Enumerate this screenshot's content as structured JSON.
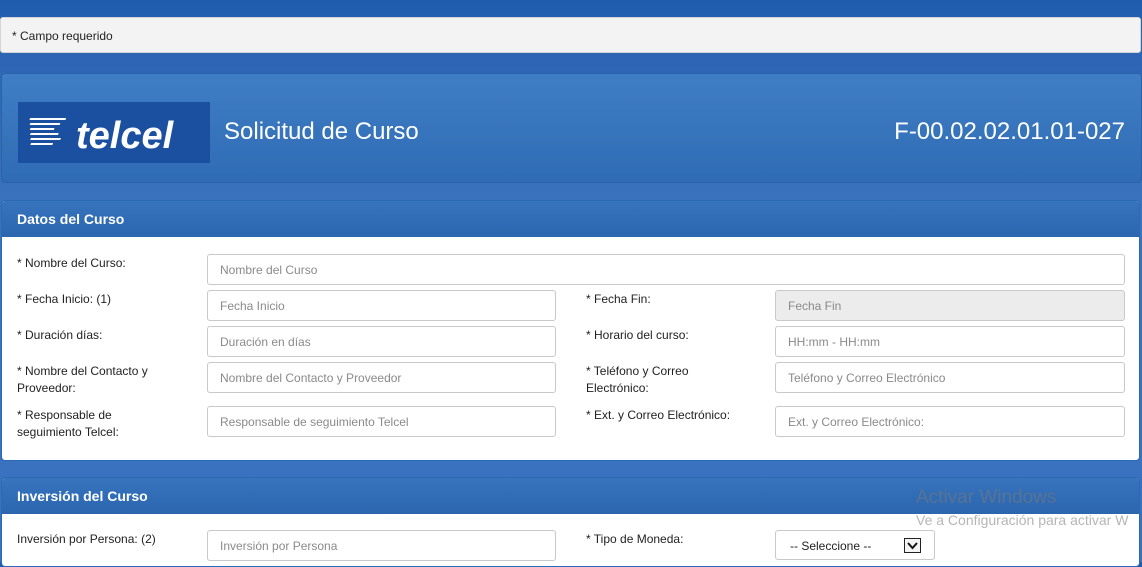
{
  "notice": {
    "required_text": "* Campo requerido"
  },
  "header": {
    "logo_text": "telcel",
    "title": "Solicitud de Curso",
    "form_code": "F-00.02.02.01.01-027"
  },
  "datos_curso": {
    "heading": "Datos del Curso",
    "fields": {
      "nombre_curso": {
        "label": "* Nombre del Curso:",
        "placeholder": "Nombre del Curso"
      },
      "fecha_inicio": {
        "label": "* Fecha Inicio: (1)",
        "placeholder": "Fecha Inicio"
      },
      "fecha_fin": {
        "label": "* Fecha Fin:",
        "placeholder": "Fecha Fin"
      },
      "duracion": {
        "label": "* Duración días:",
        "placeholder": "Duración en días"
      },
      "horario": {
        "label": "* Horario del curso:",
        "placeholder": "HH:mm - HH:mm"
      },
      "contacto": {
        "label": "* Nombre del Contacto y Proveedor:",
        "placeholder": "Nombre del Contacto y Proveedor"
      },
      "telefono": {
        "label": "* Teléfono y Correo Electrónico:",
        "placeholder": "Teléfono y Correo Electrónico"
      },
      "responsable": {
        "label": "* Responsable de seguimiento Telcel:",
        "placeholder": "Responsable de seguimiento Telcel"
      },
      "ext_correo": {
        "label": "* Ext. y Correo Electrónico:",
        "placeholder": "Ext. y Correo Electrónico:"
      }
    }
  },
  "inversion_curso": {
    "heading": "Inversión del Curso",
    "fields": {
      "inversion_persona": {
        "label": "Inversión por Persona: (2)",
        "placeholder": "Inversión por Persona"
      },
      "tipo_moneda": {
        "label": "* Tipo de Moneda:",
        "selected": "-- Seleccione --"
      }
    }
  },
  "watermark": {
    "line1": "Activar Windows",
    "line2": "Ve a Configuración para activar W"
  },
  "colors": {
    "background": "#2e66b5",
    "panel_header": "#2f6cb5",
    "logo_bg": "#1b4fa0"
  }
}
